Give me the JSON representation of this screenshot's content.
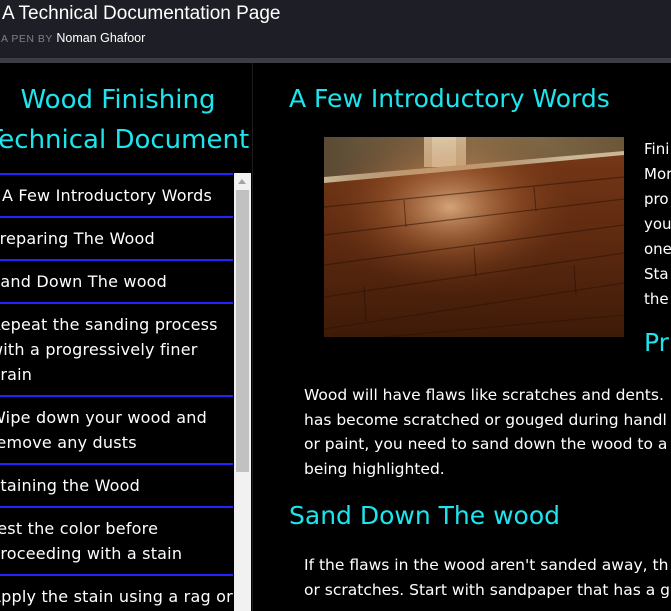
{
  "pen": {
    "title": "A Technical Documentation Page",
    "by_label": "A PEN BY",
    "author": "Noman Ghafoor"
  },
  "sidebar": {
    "title_lines": [
      "Wood Finishing",
      "Technical Document"
    ],
    "items": [
      {
        "lines": [
          "A Few Introductory Words"
        ]
      },
      {
        "lines": [
          "Preparing The Wood"
        ]
      },
      {
        "lines": [
          "Sand Down The wood"
        ]
      },
      {
        "lines": [
          "Repeat the sanding process",
          "with a progressively finer",
          "grain"
        ]
      },
      {
        "lines": [
          "Wipe down your wood and",
          "remove any dusts"
        ]
      },
      {
        "lines": [
          "Staining the Wood"
        ]
      },
      {
        "lines": [
          "Test the color before",
          "proceeding with a stain"
        ]
      },
      {
        "lines": [
          "Apply the stain using a rag or"
        ]
      }
    ]
  },
  "main": {
    "section1_heading": "A Few Introductory Words",
    "image_icon": "wood-floor-photo",
    "floated_lines": [
      "Fini",
      "Mor",
      "pro",
      "you",
      "one",
      "Sta",
      "the"
    ],
    "section2_heading_partial": "Pr",
    "section2_lines": [
      "Wood will have flaws like scratches and dents.",
      "has become scratched or gouged during handl",
      "or paint, you need to sand down the wood to a",
      "being highlighted."
    ],
    "section3_heading": "Sand Down The wood",
    "section3_lines": [
      "If the flaws in the wood aren't sanded away, th",
      "or scratches. Start with sandpaper that has a g"
    ]
  },
  "colors": {
    "accent": "#1ce5ee",
    "nav_border": "#2323ff",
    "background": "#000000",
    "header_bg": "#1e1f26"
  }
}
